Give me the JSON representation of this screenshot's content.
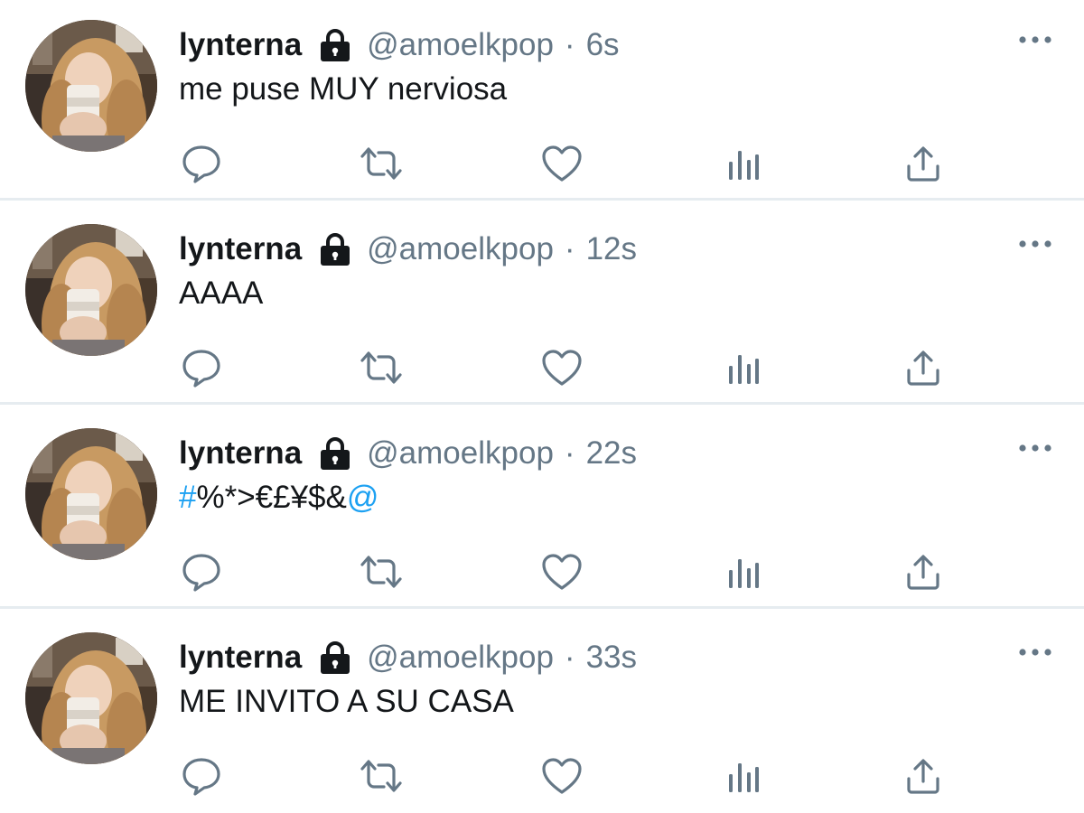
{
  "tweets": [
    {
      "name": "lynterna",
      "handle": "@amoelkpop",
      "separator": "·",
      "time": "6s",
      "text": "me puse MUY nerviosa"
    },
    {
      "name": "lynterna",
      "handle": "@amoelkpop",
      "separator": "·",
      "time": "12s",
      "text": "AAAA"
    },
    {
      "name": "lynterna",
      "handle": "@amoelkpop",
      "separator": "·",
      "time": "22s",
      "text_hashtag": "#",
      "text_middle": "%*>€£¥$&",
      "text_mention": "@"
    },
    {
      "name": "lynterna",
      "handle": "@amoelkpop",
      "separator": "·",
      "time": "33s",
      "text": "ME INVITO A SU CASA"
    }
  ],
  "icons": {
    "lock": "lock-icon",
    "more": "more-icon",
    "reply": "reply-icon",
    "retweet": "retweet-icon",
    "like": "like-icon",
    "analytics": "analytics-icon",
    "share": "share-icon"
  },
  "colors": {
    "text": "#14171a",
    "secondary": "#657786",
    "link": "#1da1f2",
    "divider": "#e6ecf0",
    "icon": "#657786"
  }
}
